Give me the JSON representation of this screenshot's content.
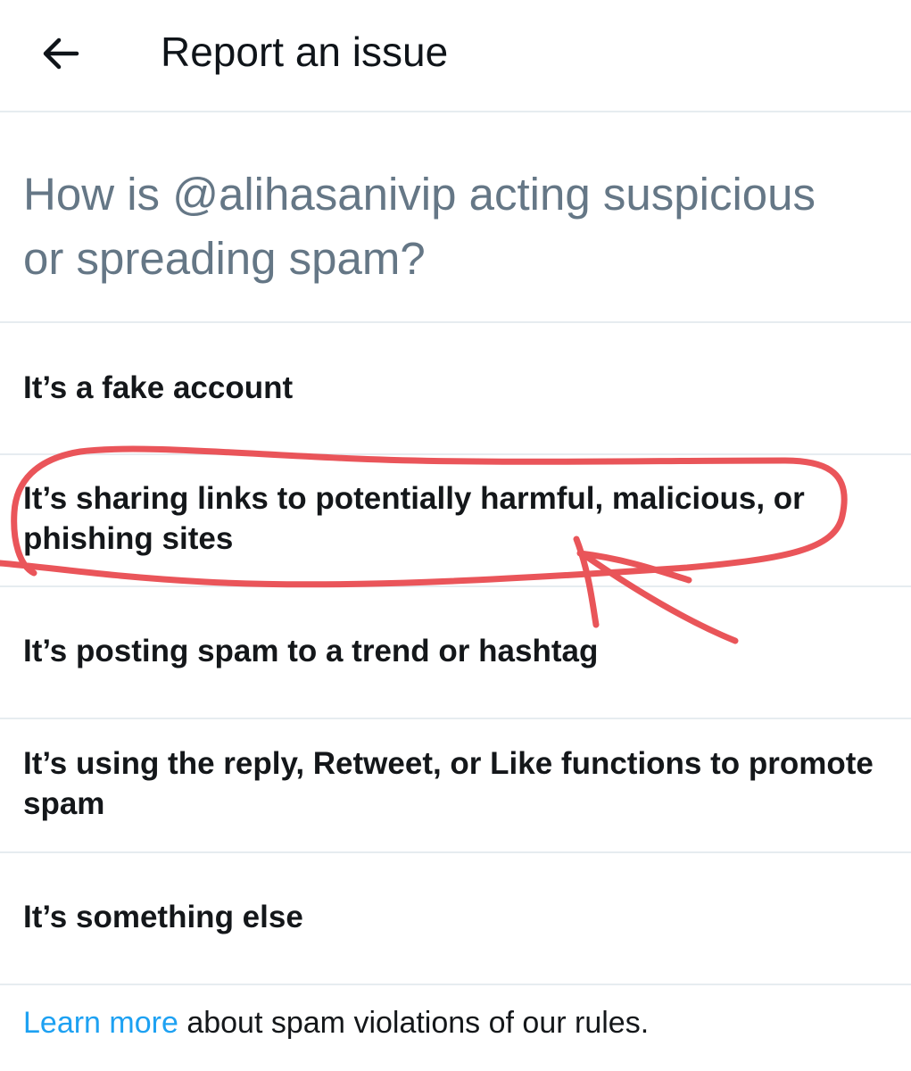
{
  "header": {
    "back_icon": "arrow-left-icon",
    "title": "Report an issue"
  },
  "question": {
    "text": "How is @alihasanivip acting suspicious or spreading spam?"
  },
  "options": [
    {
      "label": "It’s a fake account"
    },
    {
      "label": "It’s sharing links to potentially harmful, malicious, or phishing sites"
    },
    {
      "label": "It’s posting spam to a trend or hashtag"
    },
    {
      "label": "It’s using the reply, Retweet, or Like functions to promote spam"
    },
    {
      "label": "It’s something else"
    }
  ],
  "footer": {
    "link_text": "Learn more",
    "rest_text": " about spam violations of our rules."
  },
  "colors": {
    "link": "#1da1f2",
    "muted": "#657786",
    "divider": "#e6ecf0",
    "annotation": "#e8474c"
  }
}
